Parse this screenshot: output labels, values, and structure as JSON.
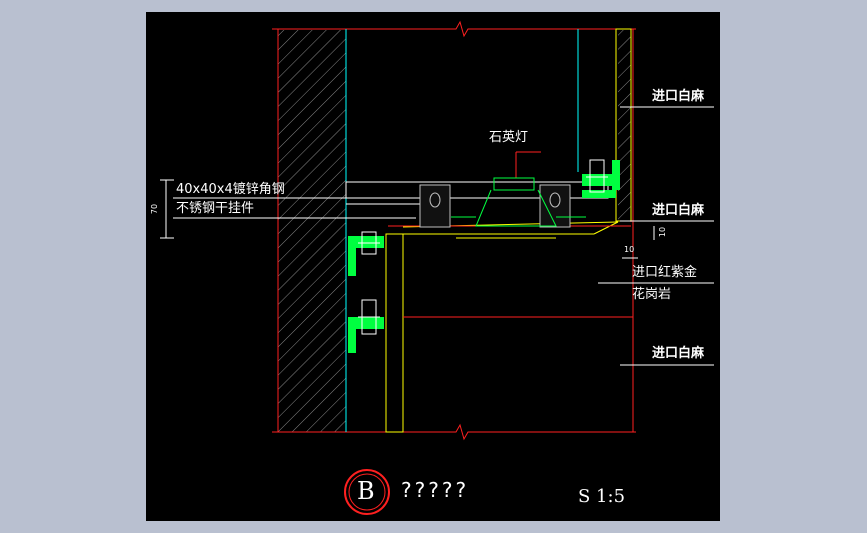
{
  "drawing": {
    "labels": {
      "quartz_lamp": "石英灯",
      "angle_steel": "40x40x4镀锌角钢",
      "hanger": "不锈钢干挂件",
      "white_marble_1": "进口白麻",
      "white_marble_2": "进口白麻",
      "red_granite_1": "进口红紫金",
      "red_granite_2": "花岗岩",
      "white_marble_3": "进口白麻"
    },
    "dims": {
      "d70": "70",
      "d10a": "10",
      "d10b": "10"
    },
    "title": {
      "letter": "B",
      "caption": "?????",
      "scale": "S 1:5"
    }
  },
  "colors": {
    "background": "#000000",
    "outer": "#b9c0d0",
    "red": "#ff2020",
    "green": "#00ff40",
    "yellow": "#ffff00",
    "cyan": "#00ffff",
    "white": "#ffffff",
    "gray": "#808080"
  }
}
